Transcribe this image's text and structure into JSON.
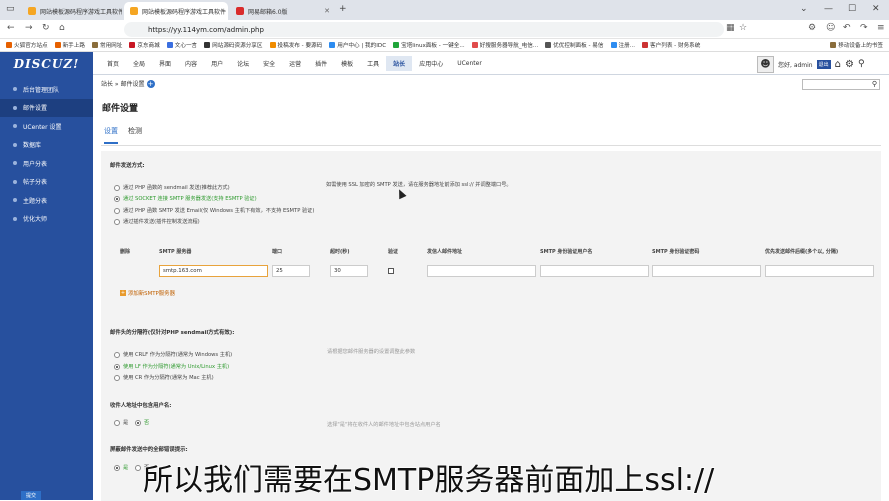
{
  "browser": {
    "tabs": [
      {
        "label": "网站模板源码程序游戏工具软件",
        "active": false
      },
      {
        "label": "网站模板源码程序游戏工具软件",
        "active": true
      },
      {
        "label": "网易邮箱6.0版",
        "active": false
      }
    ],
    "new_tab": "+",
    "url": "https://yy.114ym.com/admin.php",
    "bookmarks": [
      "火狐官方站点",
      "新手上路",
      "常用网址",
      "京东商城",
      "文心一言",
      "网站源码资源分享区",
      "投稿发布 - 要源码",
      "用户中心 | 我的IDC",
      "宝塔linux面板 - 一键全...",
      "好搜服务器导航_电信...",
      "优优控制面板 - 易信",
      "注册... ",
      "客户列表 - 财务系统",
      "移动设备上的书签"
    ]
  },
  "header": {
    "logo": "DISCUZ!",
    "nav": [
      "首页",
      "全局",
      "界面",
      "内容",
      "用户",
      "论坛",
      "安全",
      "运营",
      "插件",
      "模板",
      "工具",
      "站长",
      "应用中心",
      "UCenter"
    ],
    "nav_active": "站长",
    "greeting": "您好, admin",
    "exit_label": "退出"
  },
  "sidebar": {
    "items": [
      "后台管理团队",
      "邮件设置",
      "UCenter 设置",
      "数据库",
      "用户分表",
      "帖子分表",
      "主题分表",
      "优化大师"
    ],
    "active": "邮件设置"
  },
  "main": {
    "breadcrumb": "站长 » 邮件设置",
    "title": "邮件设置",
    "subtabs": [
      "设置",
      "检测"
    ],
    "send_method": {
      "heading": "邮件发送方式:",
      "options": [
        "通过 PHP 函数的 sendmail 发送(推荐此方式)",
        "通过 SOCKET 连接 SMTP 服务器发送(支持 ESMTP 验证)",
        "通过 PHP 函数 SMTP 发送 Email(仅 Windows 主机下有效，不支持 ESMTP 验证)",
        "通过插件发送(插件控制发送流程)"
      ],
      "selected": 1,
      "tip": "如需使用 SSL 加密的 SMTP 发送，请在服务器地址前添加 ssl:// 并调整端口号。"
    },
    "smtp_table": {
      "headers": [
        "删除",
        "SMTP 服务器",
        "端口",
        "超时(秒)",
        "验证",
        "发信人邮件地址",
        "SMTP 身份验证用户名",
        "SMTP 身份验证密码",
        "优先发送邮件后缀(多个以, 分隔)"
      ],
      "row": {
        "server": "smtp.163.com",
        "port": "25",
        "timeout": "30"
      },
      "add_label": "添加新SMTP服务器"
    },
    "separator": {
      "heading": "邮件头的分隔符(仅针对PHP sendmail方式有效):",
      "options": [
        "使用 CRLF 作为分隔符(通常为 Windows 主机)",
        "使用 LF 作为分隔符(通常为 Unix/Linux 主机)",
        "使用 CR 作为分隔符(通常为 Mac 主机)"
      ],
      "selected": 1,
      "tip": "请根据您邮件服务器的设置调整此参数"
    },
    "include_user": {
      "heading": "收件人地址中包含用户名:",
      "options": [
        "是",
        "否"
      ],
      "selected": 1,
      "tip": "选择\"是\"将在收件人的邮件地址中包含站点用户名"
    },
    "mute_errors": {
      "heading": "屏蔽邮件发送中的全部错误提示:",
      "options": [
        "是",
        "否"
      ],
      "selected": 0
    },
    "submit_label": "提交"
  },
  "video_subtitle": "所以我们需要在SMTP服务器前面加上ssl://"
}
